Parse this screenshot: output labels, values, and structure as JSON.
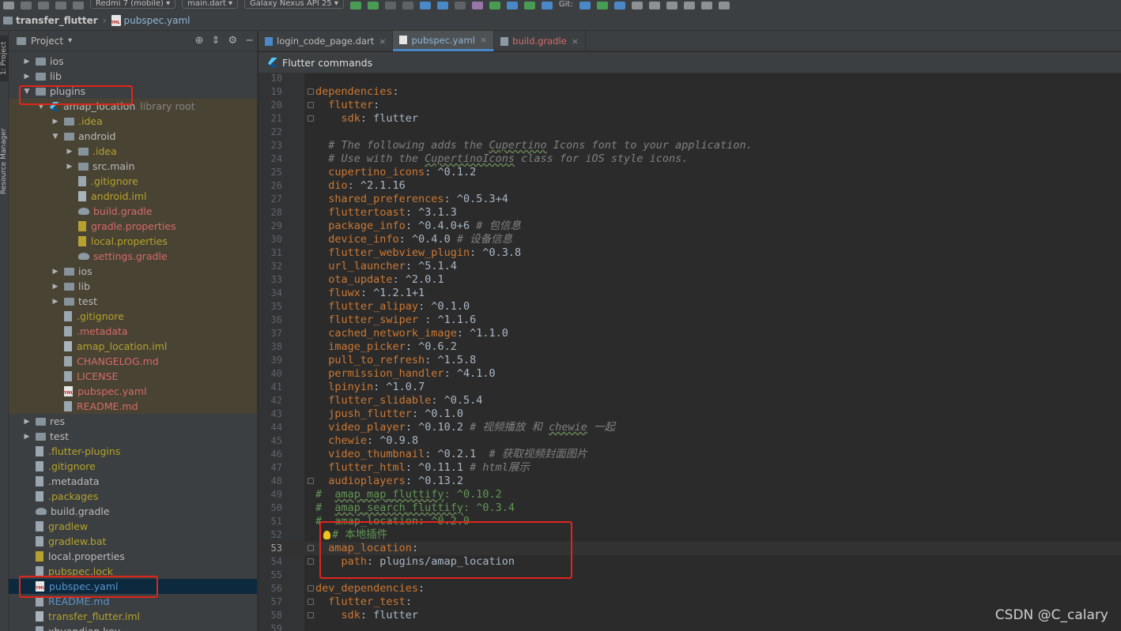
{
  "toolbar": {
    "device": "Redmi 7 (mobile)",
    "run_target": "main.dart",
    "emulator": "Galaxy Nexus API 25",
    "vcs_label": "Git:"
  },
  "navbar": {
    "project": "transfer_flutter",
    "file": "pubspec.yaml"
  },
  "left_strip": {
    "project": "1: Project",
    "resource": "Resource Manager"
  },
  "project_panel": {
    "title": "Project",
    "rows": [
      {
        "indent": 0,
        "arrow": "right",
        "icon": "folder",
        "label": "ios",
        "color": "def",
        "tint": false
      },
      {
        "indent": 0,
        "arrow": "right",
        "icon": "folder",
        "label": "lib",
        "color": "def",
        "tint": false
      },
      {
        "indent": 0,
        "arrow": "down",
        "icon": "folder",
        "label": "plugins",
        "color": "def",
        "tint": false
      },
      {
        "indent": 1,
        "arrow": "down",
        "icon": "flutter",
        "label": "amap_location",
        "extra": "library root",
        "color": "def",
        "tint": true
      },
      {
        "indent": 2,
        "arrow": "right",
        "icon": "folder",
        "label": ".idea",
        "color": "yel",
        "tint": true
      },
      {
        "indent": 2,
        "arrow": "down",
        "icon": "folder",
        "label": "android",
        "color": "def",
        "tint": true
      },
      {
        "indent": 3,
        "arrow": "right",
        "icon": "folder",
        "label": ".idea",
        "color": "yel",
        "tint": true
      },
      {
        "indent": 3,
        "arrow": "right",
        "icon": "folder",
        "label": "src.main",
        "color": "def",
        "tint": true
      },
      {
        "indent": 3,
        "arrow": "",
        "icon": "file",
        "label": ".gitignore",
        "color": "yel",
        "tint": true
      },
      {
        "indent": 3,
        "arrow": "",
        "icon": "iml",
        "label": "android.iml",
        "color": "yel",
        "tint": true
      },
      {
        "indent": 3,
        "arrow": "",
        "icon": "gradle",
        "label": "build.gradle",
        "color": "red",
        "tint": true
      },
      {
        "indent": 3,
        "arrow": "",
        "icon": "props",
        "label": "gradle.properties",
        "color": "red",
        "tint": true
      },
      {
        "indent": 3,
        "arrow": "",
        "icon": "props",
        "label": "local.properties",
        "color": "yel",
        "tint": true
      },
      {
        "indent": 3,
        "arrow": "",
        "icon": "gradle",
        "label": "settings.gradle",
        "color": "red",
        "tint": true
      },
      {
        "indent": 2,
        "arrow": "right",
        "icon": "folder",
        "label": "ios",
        "color": "def",
        "tint": true
      },
      {
        "indent": 2,
        "arrow": "right",
        "icon": "folder",
        "label": "lib",
        "color": "def",
        "tint": true
      },
      {
        "indent": 2,
        "arrow": "right",
        "icon": "folder",
        "label": "test",
        "color": "def",
        "tint": true
      },
      {
        "indent": 2,
        "arrow": "",
        "icon": "file",
        "label": ".gitignore",
        "color": "yel",
        "tint": true
      },
      {
        "indent": 2,
        "arrow": "",
        "icon": "file",
        "label": ".metadata",
        "color": "red",
        "tint": true
      },
      {
        "indent": 2,
        "arrow": "",
        "icon": "iml",
        "label": "amap_location.iml",
        "color": "yel",
        "tint": true
      },
      {
        "indent": 2,
        "arrow": "",
        "icon": "file",
        "label": "CHANGELOG.md",
        "color": "red",
        "tint": true
      },
      {
        "indent": 2,
        "arrow": "",
        "icon": "file",
        "label": "LICENSE",
        "color": "red",
        "tint": true
      },
      {
        "indent": 2,
        "arrow": "",
        "icon": "yaml",
        "label": "pubspec.yaml",
        "color": "red",
        "tint": true
      },
      {
        "indent": 2,
        "arrow": "",
        "icon": "file",
        "label": "README.md",
        "color": "red",
        "tint": true
      },
      {
        "indent": 0,
        "arrow": "right",
        "icon": "folder",
        "label": "res",
        "color": "def",
        "tint": false
      },
      {
        "indent": 0,
        "arrow": "right",
        "icon": "folder",
        "label": "test",
        "color": "def",
        "tint": false
      },
      {
        "indent": 0,
        "arrow": "",
        "icon": "file",
        "label": ".flutter-plugins",
        "color": "yel",
        "tint": false
      },
      {
        "indent": 0,
        "arrow": "",
        "icon": "file",
        "label": ".gitignore",
        "color": "yel",
        "tint": false
      },
      {
        "indent": 0,
        "arrow": "",
        "icon": "file",
        "label": ".metadata",
        "color": "def",
        "tint": false
      },
      {
        "indent": 0,
        "arrow": "",
        "icon": "file",
        "label": ".packages",
        "color": "yel",
        "tint": false
      },
      {
        "indent": 0,
        "arrow": "",
        "icon": "gradle",
        "label": "build.gradle",
        "color": "def",
        "tint": false
      },
      {
        "indent": 0,
        "arrow": "",
        "icon": "file",
        "label": "gradlew",
        "color": "yel",
        "tint": false
      },
      {
        "indent": 0,
        "arrow": "",
        "icon": "file",
        "label": "gradlew.bat",
        "color": "yel",
        "tint": false
      },
      {
        "indent": 0,
        "arrow": "",
        "icon": "props",
        "label": "local.properties",
        "color": "def",
        "tint": false
      },
      {
        "indent": 0,
        "arrow": "",
        "icon": "file",
        "label": "pubspec.lock",
        "color": "yel",
        "tint": false
      },
      {
        "indent": 0,
        "arrow": "",
        "icon": "yaml",
        "label": "pubspec.yaml",
        "color": "blue",
        "tint": false,
        "selected": true
      },
      {
        "indent": 0,
        "arrow": "",
        "icon": "file",
        "label": "README.md",
        "color": "blue",
        "tint": false
      },
      {
        "indent": 0,
        "arrow": "",
        "icon": "iml",
        "label": "transfer_flutter.iml",
        "color": "yel",
        "tint": false
      },
      {
        "indent": 0,
        "arrow": "",
        "icon": "file",
        "label": "xhyandian.key",
        "color": "def",
        "tint": false
      }
    ]
  },
  "tabs": [
    {
      "label": "login_code_page.dart",
      "icon": "dart",
      "active": false,
      "red": false
    },
    {
      "label": "pubspec.yaml",
      "icon": "yaml",
      "active": true,
      "red": false
    },
    {
      "label": "build.gradle",
      "icon": "gradle",
      "active": false,
      "red": true
    }
  ],
  "flutter_bar": {
    "label": "Flutter commands"
  },
  "editor": {
    "current_line": 53,
    "lines": [
      {
        "n": 18,
        "segs": []
      },
      {
        "n": 19,
        "segs": [
          [
            "k",
            "dependencies"
          ],
          [
            "v",
            ":"
          ]
        ]
      },
      {
        "n": 20,
        "segs": [
          [
            "v",
            "  "
          ],
          [
            "k",
            "flutter"
          ],
          [
            "v",
            ":"
          ]
        ]
      },
      {
        "n": 21,
        "segs": [
          [
            "v",
            "    "
          ],
          [
            "k",
            "sdk"
          ],
          [
            "v",
            ": flutter"
          ]
        ]
      },
      {
        "n": 22,
        "segs": []
      },
      {
        "n": 23,
        "segs": [
          [
            "cm",
            "  # The following adds the "
          ],
          [
            "cmu",
            "Cupertino"
          ],
          [
            "cm",
            " Icons font to your application."
          ]
        ]
      },
      {
        "n": 24,
        "segs": [
          [
            "cm",
            "  # Use with the "
          ],
          [
            "cmu",
            "CupertinoIcons"
          ],
          [
            "cm",
            " class for iOS style icons."
          ]
        ]
      },
      {
        "n": 25,
        "segs": [
          [
            "v",
            "  "
          ],
          [
            "k",
            "cupertino_icons"
          ],
          [
            "v",
            ": ^0.1.2"
          ]
        ]
      },
      {
        "n": 26,
        "segs": [
          [
            "v",
            "  "
          ],
          [
            "k",
            "dio"
          ],
          [
            "v",
            ": ^2.1.16"
          ]
        ]
      },
      {
        "n": 27,
        "segs": [
          [
            "v",
            "  "
          ],
          [
            "k",
            "shared_preferences"
          ],
          [
            "v",
            ": ^0.5.3+4"
          ]
        ]
      },
      {
        "n": 28,
        "segs": [
          [
            "v",
            "  "
          ],
          [
            "k",
            "fluttertoast"
          ],
          [
            "v",
            ": ^3.1.3"
          ]
        ]
      },
      {
        "n": 29,
        "segs": [
          [
            "v",
            "  "
          ],
          [
            "k",
            "package_info"
          ],
          [
            "v",
            ": ^0.4.0+6 "
          ],
          [
            "cm",
            "# 包信息"
          ]
        ]
      },
      {
        "n": 30,
        "segs": [
          [
            "v",
            "  "
          ],
          [
            "k",
            "device_info"
          ],
          [
            "v",
            ": ^0.4.0 "
          ],
          [
            "cm",
            "# 设备信息"
          ]
        ]
      },
      {
        "n": 31,
        "segs": [
          [
            "v",
            "  "
          ],
          [
            "k",
            "flutter_webview_plugin"
          ],
          [
            "v",
            ": ^0.3.8"
          ]
        ]
      },
      {
        "n": 32,
        "segs": [
          [
            "v",
            "  "
          ],
          [
            "k",
            "url_launcher"
          ],
          [
            "v",
            ": ^5.1.4"
          ]
        ]
      },
      {
        "n": 33,
        "segs": [
          [
            "v",
            "  "
          ],
          [
            "k",
            "ota_update"
          ],
          [
            "v",
            ": ^2.0.1"
          ]
        ]
      },
      {
        "n": 34,
        "segs": [
          [
            "v",
            "  "
          ],
          [
            "k",
            "fluwx"
          ],
          [
            "v",
            ": ^1.2.1+1"
          ]
        ]
      },
      {
        "n": 35,
        "segs": [
          [
            "v",
            "  "
          ],
          [
            "k",
            "flutter_alipay"
          ],
          [
            "v",
            ": ^0.1.0"
          ]
        ]
      },
      {
        "n": 36,
        "segs": [
          [
            "v",
            "  "
          ],
          [
            "k",
            "flutter_swiper"
          ],
          [
            "v",
            " : ^1.1.6"
          ]
        ]
      },
      {
        "n": 37,
        "segs": [
          [
            "v",
            "  "
          ],
          [
            "k",
            "cached_network_image"
          ],
          [
            "v",
            ": ^1.1.0"
          ]
        ]
      },
      {
        "n": 38,
        "segs": [
          [
            "v",
            "  "
          ],
          [
            "k",
            "image_picker"
          ],
          [
            "v",
            ": ^0.6.2"
          ]
        ]
      },
      {
        "n": 39,
        "segs": [
          [
            "v",
            "  "
          ],
          [
            "k",
            "pull_to_refresh"
          ],
          [
            "v",
            ": ^1.5.8"
          ]
        ]
      },
      {
        "n": 40,
        "segs": [
          [
            "v",
            "  "
          ],
          [
            "k",
            "permission_handler"
          ],
          [
            "v",
            ": ^4.1.0"
          ]
        ]
      },
      {
        "n": 41,
        "segs": [
          [
            "v",
            "  "
          ],
          [
            "k",
            "lpinyin"
          ],
          [
            "v",
            ": ^1.0.7"
          ]
        ]
      },
      {
        "n": 42,
        "segs": [
          [
            "v",
            "  "
          ],
          [
            "k",
            "flutter_slidable"
          ],
          [
            "v",
            ": ^0.5.4"
          ]
        ]
      },
      {
        "n": 43,
        "segs": [
          [
            "v",
            "  "
          ],
          [
            "k",
            "jpush_flutter"
          ],
          [
            "v",
            ": ^0.1.0"
          ]
        ]
      },
      {
        "n": 44,
        "segs": [
          [
            "v",
            "  "
          ],
          [
            "k",
            "video_player"
          ],
          [
            "v",
            ": ^0.10.2 "
          ],
          [
            "cm",
            "# 视频播放 和 "
          ],
          [
            "cmu",
            "chewie"
          ],
          [
            "cm",
            " 一起"
          ]
        ]
      },
      {
        "n": 45,
        "segs": [
          [
            "v",
            "  "
          ],
          [
            "k",
            "chewie"
          ],
          [
            "v",
            ": ^0.9.8"
          ]
        ]
      },
      {
        "n": 46,
        "segs": [
          [
            "v",
            "  "
          ],
          [
            "k",
            "video_thumbnail"
          ],
          [
            "v",
            ": ^0.2.1  "
          ],
          [
            "cm",
            "# 获取视频封面图片"
          ]
        ]
      },
      {
        "n": 47,
        "segs": [
          [
            "v",
            "  "
          ],
          [
            "k",
            "flutter_html"
          ],
          [
            "v",
            ": ^0.11.1 "
          ],
          [
            "cm",
            "# html展示"
          ]
        ]
      },
      {
        "n": 48,
        "segs": [
          [
            "v",
            "  "
          ],
          [
            "k",
            "audioplayers"
          ],
          [
            "v",
            ": ^0.13.2"
          ]
        ]
      },
      {
        "n": 49,
        "segs": [
          [
            "cmc",
            "#  "
          ],
          [
            "cmcu",
            "amap_map_fluttify"
          ],
          [
            "cmc",
            ": ^0.10.2"
          ]
        ]
      },
      {
        "n": 50,
        "segs": [
          [
            "cmc",
            "#  "
          ],
          [
            "cmcu",
            "amap_search_fluttify"
          ],
          [
            "cmc",
            ": ^0.3.4"
          ]
        ]
      },
      {
        "n": 51,
        "segs": [
          [
            "cmc",
            "#  amap_location: ^0.2.0"
          ]
        ]
      },
      {
        "n": 52,
        "segs": [
          [
            "bulb",
            ""
          ],
          [
            "cmc",
            "# 本地插件"
          ]
        ]
      },
      {
        "n": 53,
        "segs": [
          [
            "v",
            "  "
          ],
          [
            "k",
            "amap_location"
          ],
          [
            "v",
            ":"
          ]
        ]
      },
      {
        "n": 54,
        "segs": [
          [
            "v",
            "    "
          ],
          [
            "k",
            "path"
          ],
          [
            "v",
            ": plugins/amap_location"
          ]
        ]
      },
      {
        "n": 55,
        "segs": []
      },
      {
        "n": 56,
        "segs": [
          [
            "k",
            "dev_dependencies"
          ],
          [
            "v",
            ":"
          ]
        ]
      },
      {
        "n": 57,
        "segs": [
          [
            "v",
            "  "
          ],
          [
            "k",
            "flutter_test"
          ],
          [
            "v",
            ":"
          ]
        ]
      },
      {
        "n": 58,
        "segs": [
          [
            "v",
            "    "
          ],
          [
            "k",
            "sdk"
          ],
          [
            "v",
            ": flutter"
          ]
        ]
      },
      {
        "n": 59,
        "segs": []
      }
    ]
  },
  "watermark": "CSDN @C_calary",
  "colors": {
    "annotation_red": "#e0251b",
    "keyword": "#cc7832",
    "comment": "#808080",
    "selection": "#0d293e"
  }
}
